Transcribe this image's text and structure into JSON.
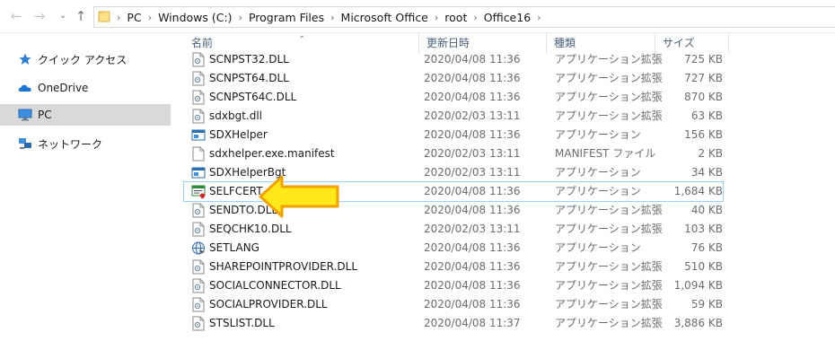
{
  "address_bar": {
    "crumbs": [
      "PC",
      "Windows (C:)",
      "Program Files",
      "Microsoft Office",
      "root",
      "Office16"
    ]
  },
  "nav_pane": {
    "items": [
      {
        "label": "クイック アクセス",
        "icon": "star-icon",
        "selected": false
      },
      {
        "label": "OneDrive",
        "icon": "cloud-icon",
        "selected": false
      },
      {
        "label": "PC",
        "icon": "computer-icon",
        "selected": true
      },
      {
        "label": "ネットワーク",
        "icon": "network-icon",
        "selected": false
      }
    ]
  },
  "columns": {
    "name": "名前",
    "date": "更新日時",
    "type": "種類",
    "size": "サイズ"
  },
  "files": [
    {
      "name": "SCNPST32.DLL",
      "date": "2020/04/08 11:36",
      "type": "アプリケーション拡張",
      "size": "725 KB",
      "icon": "dll-icon"
    },
    {
      "name": "SCNPST64.DLL",
      "date": "2020/04/08 11:36",
      "type": "アプリケーション拡張",
      "size": "727 KB",
      "icon": "dll-icon"
    },
    {
      "name": "SCNPST64C.DLL",
      "date": "2020/04/08 11:36",
      "type": "アプリケーション拡張",
      "size": "870 KB",
      "icon": "dll-icon"
    },
    {
      "name": "sdxbgt.dll",
      "date": "2020/02/03 13:11",
      "type": "アプリケーション拡張",
      "size": "63 KB",
      "icon": "dll-icon"
    },
    {
      "name": "SDXHelper",
      "date": "2020/04/08 11:36",
      "type": "アプリケーション",
      "size": "156 KB",
      "icon": "app-icon"
    },
    {
      "name": "sdxhelper.exe.manifest",
      "date": "2020/02/03 13:11",
      "type": "MANIFEST ファイル",
      "size": "2 KB",
      "icon": "file-icon"
    },
    {
      "name": "SDXHelperBgt",
      "date": "2020/02/03 13:11",
      "type": "アプリケーション",
      "size": "34 KB",
      "icon": "app-icon"
    },
    {
      "name": "SELFCERT",
      "date": "2020/04/08 11:36",
      "type": "アプリケーション",
      "size": "1,684 KB",
      "icon": "certificate-icon",
      "selected": true
    },
    {
      "name": "SENDTO.DLL",
      "date": "2020/04/08 11:36",
      "type": "アプリケーション拡張",
      "size": "40 KB",
      "icon": "dll-icon"
    },
    {
      "name": "SEQCHK10.DLL",
      "date": "2020/02/03 13:11",
      "type": "アプリケーション拡張",
      "size": "103 KB",
      "icon": "dll-icon"
    },
    {
      "name": "SETLANG",
      "date": "2020/04/08 11:36",
      "type": "アプリケーション",
      "size": "76 KB",
      "icon": "globe-icon"
    },
    {
      "name": "SHAREPOINTPROVIDER.DLL",
      "date": "2020/04/08 11:36",
      "type": "アプリケーション拡張",
      "size": "510 KB",
      "icon": "dll-icon"
    },
    {
      "name": "SOCIALCONNECTOR.DLL",
      "date": "2020/04/08 11:36",
      "type": "アプリケーション拡張",
      "size": "1,094 KB",
      "icon": "dll-icon"
    },
    {
      "name": "SOCIALPROVIDER.DLL",
      "date": "2020/04/08 11:36",
      "type": "アプリケーション拡張",
      "size": "59 KB",
      "icon": "dll-icon"
    },
    {
      "name": "STSLIST.DLL",
      "date": "2020/04/08 11:37",
      "type": "アプリケーション拡張",
      "size": "3,886 KB",
      "icon": "dll-icon"
    }
  ],
  "colors": {
    "header_text": "#4c607a",
    "selection_border": "#99d1ff",
    "nav_selected_bg": "#d9d9d9",
    "arrow_fill": "#ffe81a",
    "arrow_stroke": "#f5a100"
  }
}
